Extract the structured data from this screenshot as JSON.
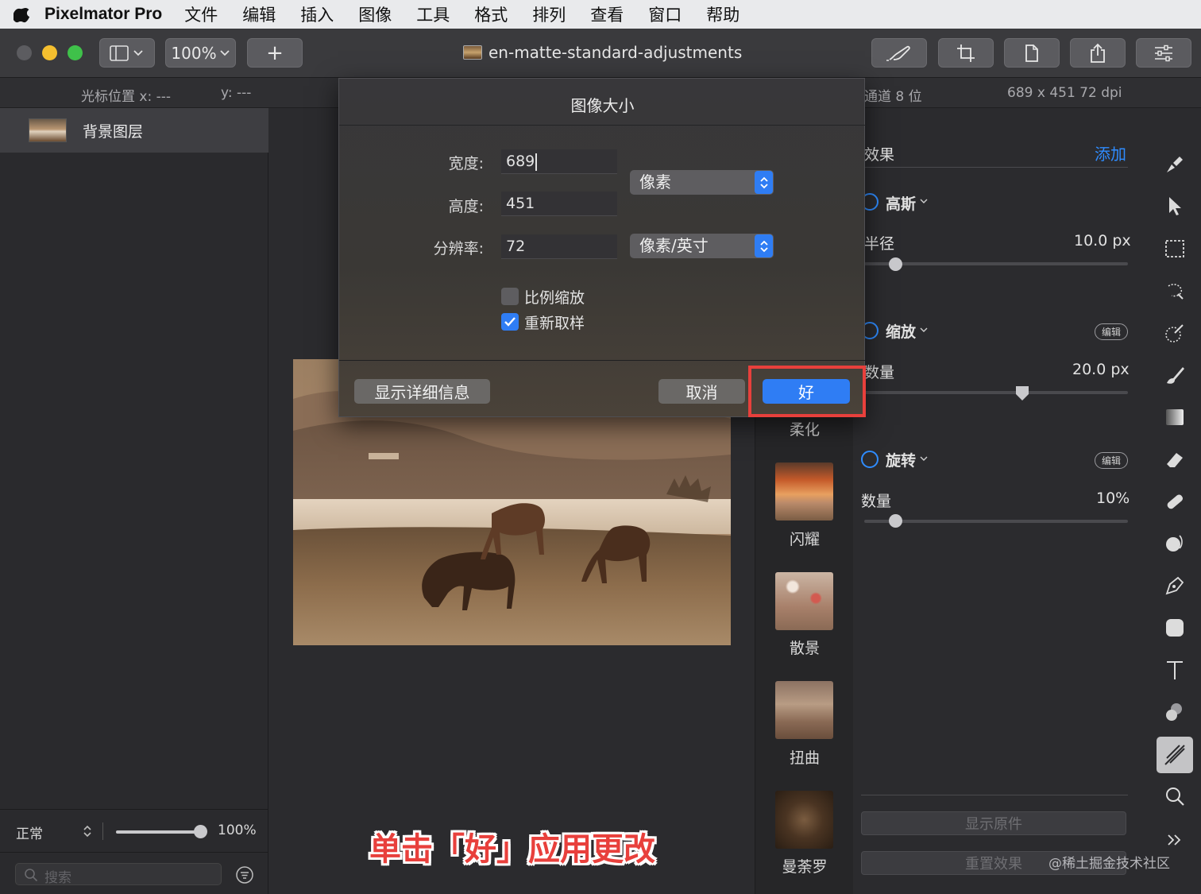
{
  "menubar": {
    "app_name": "Pixelmator Pro",
    "items": [
      "文件",
      "编辑",
      "插入",
      "图像",
      "工具",
      "格式",
      "排列",
      "查看",
      "窗口",
      "帮助"
    ]
  },
  "toolbar": {
    "zoom_label": "100%",
    "add_label": "+",
    "document_title": "en-matte-standard-adjustments"
  },
  "infobar": {
    "cursor_x": "光标位置 x: ---",
    "cursor_y": "y: ---",
    "channel_info": "通道 8 位",
    "image_info": "689 x 451 72 dpi"
  },
  "layers": {
    "items": [
      {
        "name": "背景图层"
      }
    ],
    "blend_mode": "正常",
    "opacity": "100%",
    "opacity_value": 1.0,
    "search_placeholder": "搜索"
  },
  "dialog": {
    "title": "图像大小",
    "width_label": "宽度:",
    "width_value": "689",
    "height_label": "高度:",
    "height_value": "451",
    "resolution_label": "分辨率:",
    "resolution_value": "72",
    "size_unit": "像素",
    "resolution_unit": "像素/英寸",
    "scale_proportionally_label": "比例缩放",
    "scale_proportionally_checked": false,
    "resample_label": "重新取样",
    "resample_checked": true,
    "details_button": "显示详细信息",
    "cancel_button": "取消",
    "ok_button": "好"
  },
  "effects_browser": {
    "items": [
      {
        "label": "柔化"
      },
      {
        "label": "闪耀"
      },
      {
        "label": "散景"
      },
      {
        "label": "扭曲"
      },
      {
        "label": "曼荼罗"
      }
    ]
  },
  "effects_settings": {
    "header": "效果",
    "add_label": "添加",
    "groups": [
      {
        "name": "高斯",
        "param_label": "半径",
        "param_value": "10.0 px",
        "slider_fraction": 0.12
      },
      {
        "name": "缩放",
        "edit_label": "编辑",
        "param_label": "数量",
        "param_value": "20.0 px",
        "slider_fraction": 0.6
      },
      {
        "name": "旋转",
        "edit_label": "编辑",
        "param_label": "数量",
        "param_value": "10%",
        "slider_fraction": 0.12
      }
    ],
    "show_original": "显示原件",
    "reset_effects": "重置效果"
  },
  "annotation": {
    "caption": "单击「好」应用更改",
    "watermark": "@稀土掘金技术社区"
  },
  "colors": {
    "accent_blue": "#2f7df4",
    "highlight_red": "#e8403c",
    "traffic_red": "#5c5c60",
    "traffic_yellow": "#f5bf2f",
    "traffic_green": "#3fc14a"
  }
}
